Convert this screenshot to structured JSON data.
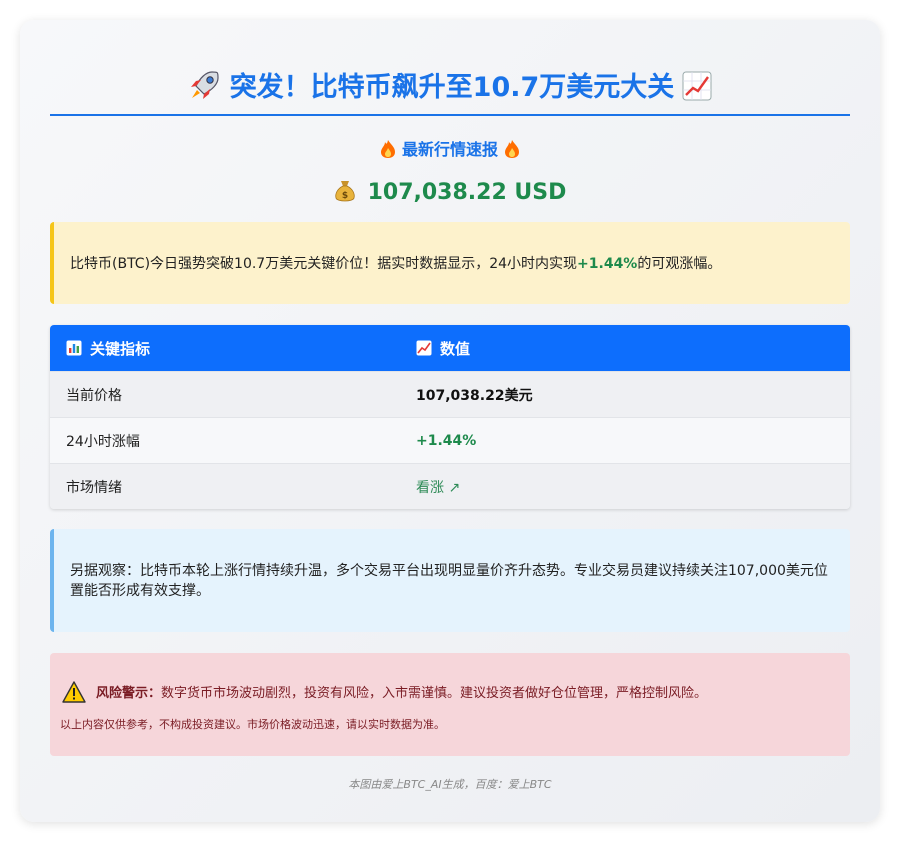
{
  "header": {
    "title": "突发！比特币飙升至10.7万美元大关",
    "subtitle": "最新行情速报",
    "price": "107,038.22 USD"
  },
  "intro": {
    "text_before": "比特币(BTC)今日强势突破10.7万美元关键价位！据实时数据显示，24小时内实现",
    "highlight": "+1.44%",
    "text_after": "的可观涨幅。"
  },
  "table": {
    "headers": [
      "关键指标",
      "数值"
    ],
    "rows": [
      {
        "label": "当前价格",
        "value": "107,038.22美元"
      },
      {
        "label": "24小时涨幅",
        "value": "+1.44%"
      },
      {
        "label": "市场情绪",
        "value": "看涨 ↗"
      }
    ]
  },
  "observation": {
    "text": "另据观察：比特币本轮上涨行情持续升温，多个交易平台出现明显量价齐升态势。专业交易员建议持续关注107,000美元位置能否形成有效支撑。"
  },
  "risk": {
    "label": "风险警示：",
    "text": "数字货币市场波动剧烈，投资有风险，入市需谨慎。建议投资者做好仓位管理，严格控制风险。",
    "note": "以上内容仅供参考，不构成投资建议。市场价格波动迅速，请以实时数据为准。"
  },
  "footer": {
    "text": "本图由爱上BTC_AI生成，百度：爱上BTC"
  },
  "colors": {
    "accent": "#1a73e8",
    "table_header": "#0d6efd",
    "positive": "#1e8a4c",
    "warning_bg": "#f6d6da"
  }
}
